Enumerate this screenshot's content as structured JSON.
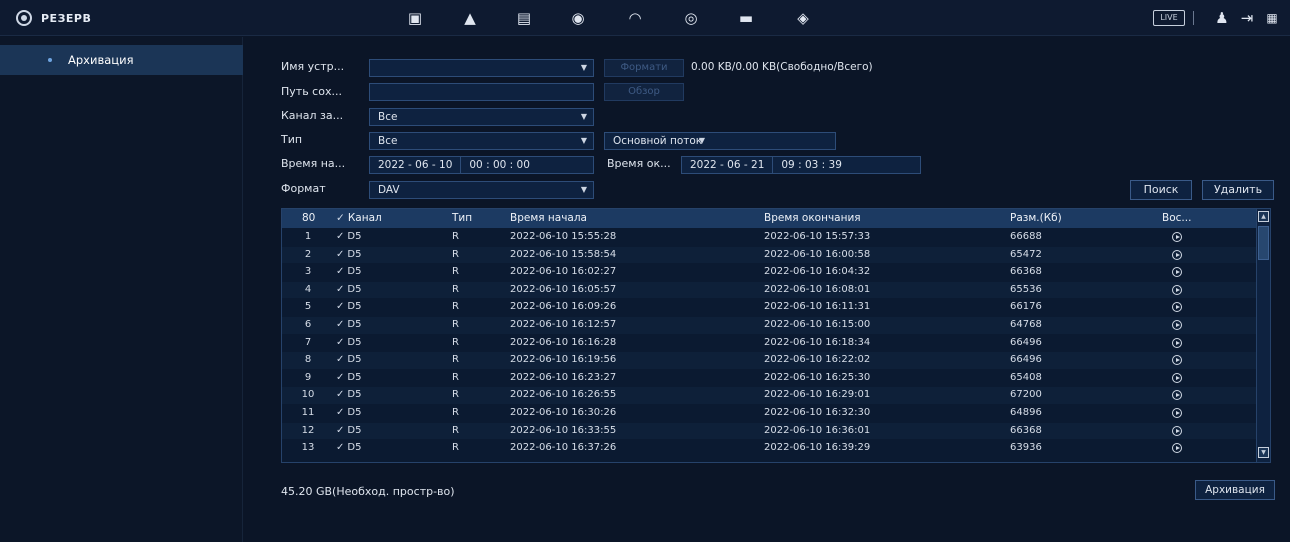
{
  "app": {
    "title": "РЕЗЕРВ"
  },
  "topbar": {
    "icons": [
      "camera-icon",
      "alarm-icon",
      "storage-icon",
      "ai-icon",
      "performance-icon",
      "record-icon",
      "display-icon",
      "audio-icon"
    ],
    "live_label": "LIVE"
  },
  "sidebar": {
    "items": [
      {
        "label": "Архивация"
      }
    ]
  },
  "form": {
    "device_label": "Имя устр...",
    "device_value": "",
    "format_button": "Формати",
    "capacity_text": "0.00 KB/0.00 KB(Свободно/Всего)",
    "path_label": "Путь сох...",
    "path_value": "",
    "browse_button": "Обзор",
    "channel_label": "Канал за...",
    "channel_value": "Все",
    "type_label": "Тип",
    "type_value": "Все",
    "stream_value": "Основной поток",
    "start_label": "Время на...",
    "start_date": "2022 - 06 - 10",
    "start_time": "00 : 00 : 00",
    "end_label": "Время ок...",
    "end_date": "2022 - 06 - 21",
    "end_time": "09 : 03 : 39",
    "format_label": "Формат",
    "format_value": "DAV",
    "search_button": "Поиск",
    "delete_button": "Удалить"
  },
  "table": {
    "headers": {
      "count": "80",
      "channel": "Канал",
      "type": "Тип",
      "start": "Время начала",
      "end": "Время окончания",
      "size": "Разм.(Кб)",
      "play": "Вос..."
    },
    "rows": [
      {
        "no": "1",
        "channel": "D5",
        "type": "R",
        "start": "2022-06-10 15:55:28",
        "end": "2022-06-10 15:57:33",
        "size": "66688"
      },
      {
        "no": "2",
        "channel": "D5",
        "type": "R",
        "start": "2022-06-10 15:58:54",
        "end": "2022-06-10 16:00:58",
        "size": "65472"
      },
      {
        "no": "3",
        "channel": "D5",
        "type": "R",
        "start": "2022-06-10 16:02:27",
        "end": "2022-06-10 16:04:32",
        "size": "66368"
      },
      {
        "no": "4",
        "channel": "D5",
        "type": "R",
        "start": "2022-06-10 16:05:57",
        "end": "2022-06-10 16:08:01",
        "size": "65536"
      },
      {
        "no": "5",
        "channel": "D5",
        "type": "R",
        "start": "2022-06-10 16:09:26",
        "end": "2022-06-10 16:11:31",
        "size": "66176"
      },
      {
        "no": "6",
        "channel": "D5",
        "type": "R",
        "start": "2022-06-10 16:12:57",
        "end": "2022-06-10 16:15:00",
        "size": "64768"
      },
      {
        "no": "7",
        "channel": "D5",
        "type": "R",
        "start": "2022-06-10 16:16:28",
        "end": "2022-06-10 16:18:34",
        "size": "66496"
      },
      {
        "no": "8",
        "channel": "D5",
        "type": "R",
        "start": "2022-06-10 16:19:56",
        "end": "2022-06-10 16:22:02",
        "size": "66496"
      },
      {
        "no": "9",
        "channel": "D5",
        "type": "R",
        "start": "2022-06-10 16:23:27",
        "end": "2022-06-10 16:25:30",
        "size": "65408"
      },
      {
        "no": "10",
        "channel": "D5",
        "type": "R",
        "start": "2022-06-10 16:26:55",
        "end": "2022-06-10 16:29:01",
        "size": "67200"
      },
      {
        "no": "11",
        "channel": "D5",
        "type": "R",
        "start": "2022-06-10 16:30:26",
        "end": "2022-06-10 16:32:30",
        "size": "64896"
      },
      {
        "no": "12",
        "channel": "D5",
        "type": "R",
        "start": "2022-06-10 16:33:55",
        "end": "2022-06-10 16:36:01",
        "size": "66368"
      },
      {
        "no": "13",
        "channel": "D5",
        "type": "R",
        "start": "2022-06-10 16:37:26",
        "end": "2022-06-10 16:39:29",
        "size": "63936"
      }
    ]
  },
  "footer": {
    "required_space": "45.20 GB(Необход. простр-во)",
    "backup_button": "Архивация"
  }
}
